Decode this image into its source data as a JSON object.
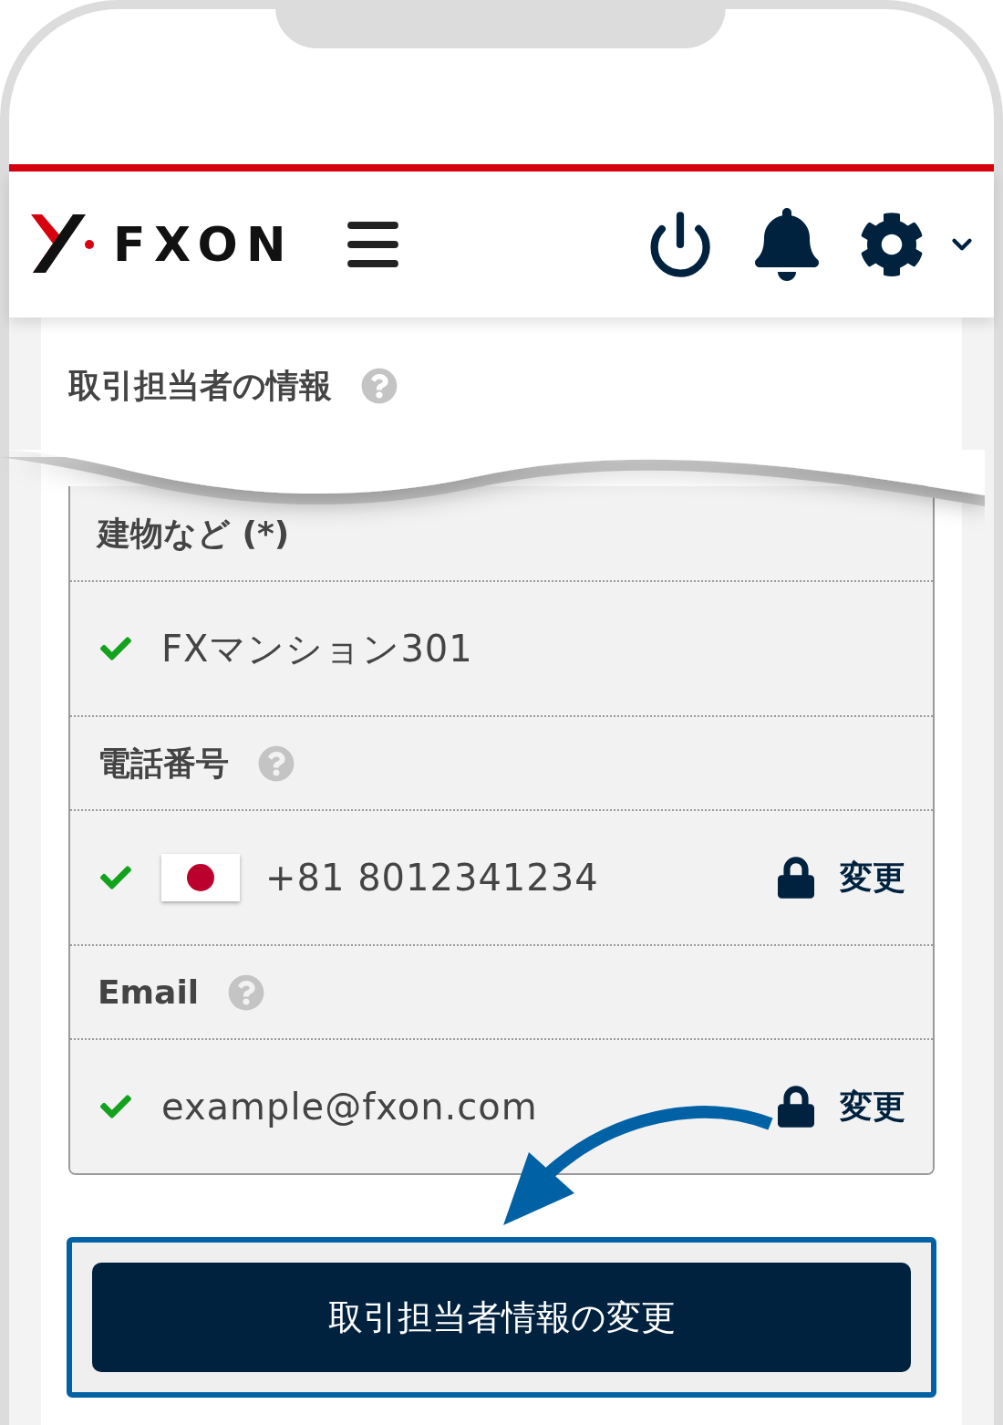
{
  "header": {
    "logo_text": "FXON"
  },
  "section": {
    "title": "取引担当者の情報",
    "help": true
  },
  "rows": [
    {
      "kind": "label",
      "text": "建物など (*)",
      "help": false
    },
    {
      "kind": "value",
      "text": "FXマンション301",
      "verified": true,
      "flag": false
    },
    {
      "kind": "label",
      "text": "電話番号",
      "help": true
    },
    {
      "kind": "value",
      "text": "+81 8012341234",
      "verified": true,
      "flag": true,
      "action": "変更"
    },
    {
      "kind": "label",
      "text": "Email",
      "help": true
    },
    {
      "kind": "value",
      "text": "example@fxon.com",
      "verified": true,
      "flag": false,
      "action": "変更"
    }
  ],
  "button": {
    "label": "取引担当者情報の変更",
    "highlighted": true
  }
}
